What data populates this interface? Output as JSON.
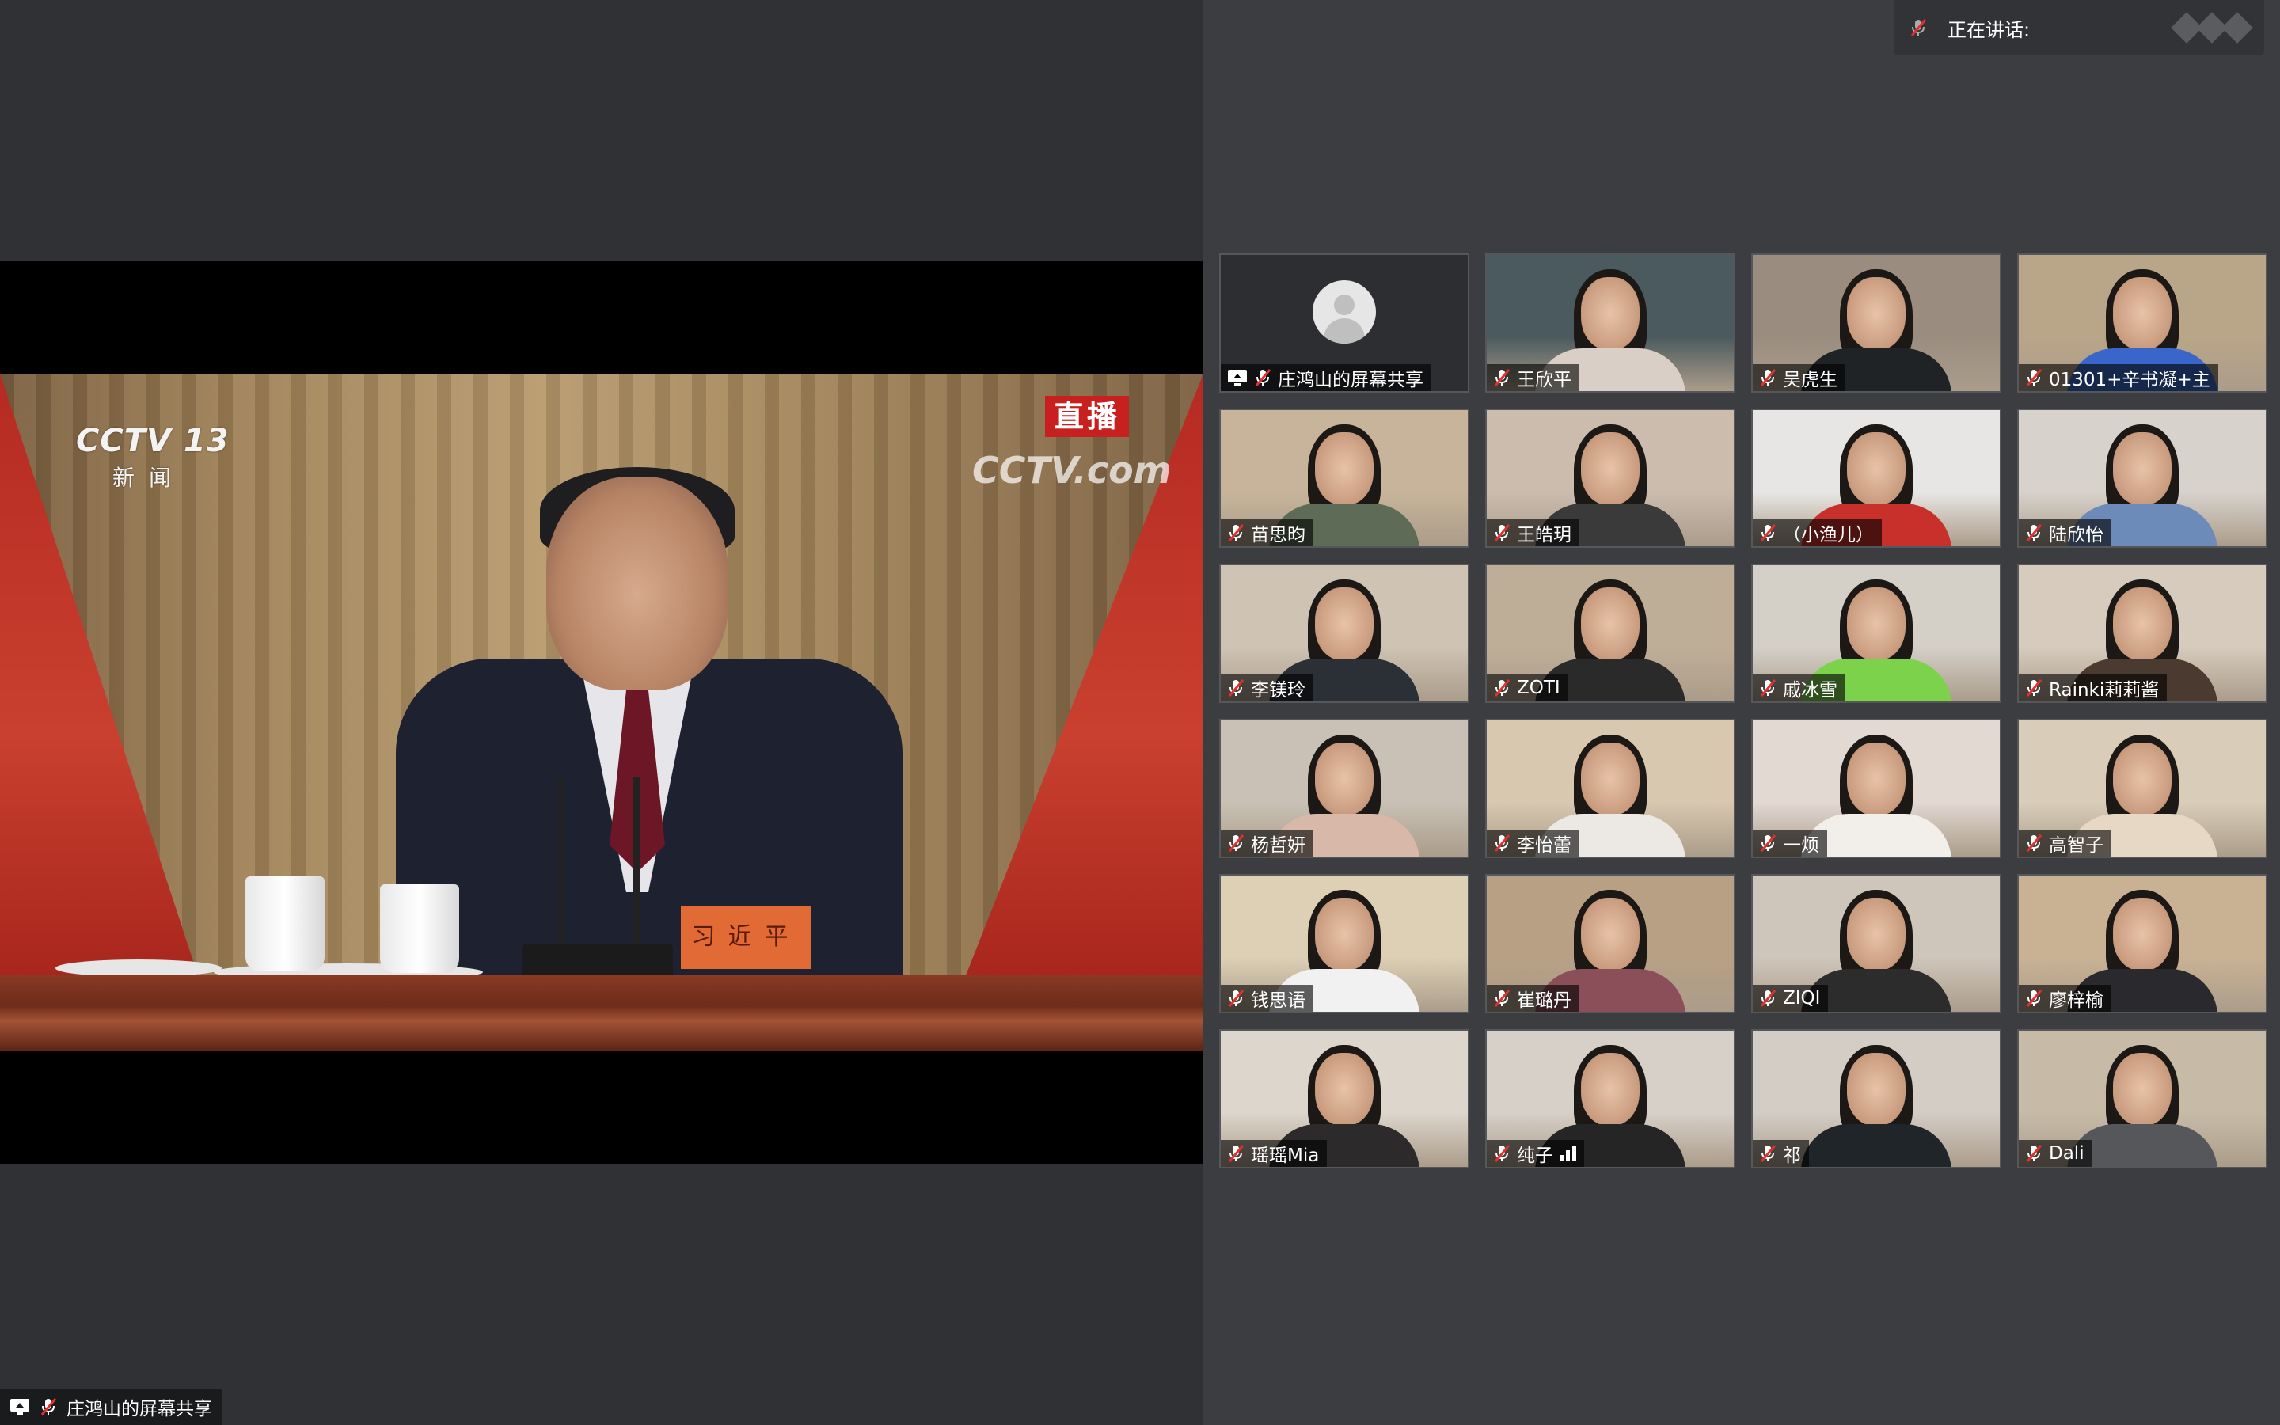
{
  "shared_screen": {
    "cctv_brand": "CCTV 13",
    "cctv_channel": "新闻",
    "live_badge": "直播",
    "watermark": "CCTV.com",
    "nameplate": "习近平"
  },
  "share_label": "庄鸿山的屏幕共享",
  "talking_bar": {
    "label": "正在讲话:"
  },
  "participants": [
    {
      "name": "庄鸿山的屏幕共享",
      "type": "avatar",
      "screen_share": true,
      "bg": "#2d2e32"
    },
    {
      "name": "王欣平",
      "bg": "#4a5a5e",
      "torso": "#d9cfc6"
    },
    {
      "name": "吴虎生",
      "bg": "#9a8d80",
      "torso": "#1f2325"
    },
    {
      "name": "01301+辛书凝+主",
      "bg": "#b9a588",
      "torso": "#3a66c9"
    },
    {
      "name": "苗思昀",
      "bg": "#c7b49a",
      "torso": "#5e6b56"
    },
    {
      "name": "王皓玥",
      "bg": "#cbbcae",
      "torso": "#3a3a3a"
    },
    {
      "name": "（小渔儿）",
      "bg": "#e8e6e4",
      "torso": "#c8302c"
    },
    {
      "name": "陆欣怡",
      "bg": "#d8d2cc",
      "torso": "#6d8bb8"
    },
    {
      "name": "李镁玲",
      "bg": "#cfc3b4",
      "torso": "#2b2f36"
    },
    {
      "name": "ZOTI",
      "bg": "#bfae97",
      "torso": "#2a2a2a"
    },
    {
      "name": "戚冰雪",
      "bg": "#d4d0c8",
      "torso": "#7cd24a"
    },
    {
      "name": "Rainki莉莉酱",
      "bg": "#d6cbbd",
      "torso": "#4a3a30"
    },
    {
      "name": "杨哲妍",
      "bg": "#c9c1b5",
      "torso": "#d8b8a8"
    },
    {
      "name": "李怡蕾",
      "bg": "#d8c8b0",
      "torso": "#ece9e4"
    },
    {
      "name": "一烦",
      "bg": "#e3d9d3",
      "torso": "#f2eeea"
    },
    {
      "name": "高智子",
      "bg": "#d9cdb9",
      "torso": "#e6d8c4"
    },
    {
      "name": "钱思语",
      "bg": "#ddd0b5",
      "torso": "#f1f1f1"
    },
    {
      "name": "崔璐丹",
      "bg": "#b8a085",
      "torso": "#8b4f5a"
    },
    {
      "name": "ZIQI",
      "bg": "#cfc6bb",
      "torso": "#2c2c2c"
    },
    {
      "name": "廖梓榆",
      "bg": "#c9b294",
      "torso": "#2a2a2e"
    },
    {
      "name": "瑶瑶Mia",
      "bg": "#ddd6cc",
      "torso": "#2c2a2a"
    },
    {
      "name": "纯子",
      "bg": "#d7d0c8",
      "torso": "#252525",
      "signal": true
    },
    {
      "name": "祁",
      "bg": "#d4cdc6",
      "torso": "#1f2528"
    },
    {
      "name": "Dali",
      "bg": "#c7bba8",
      "torso": "#55575a"
    }
  ]
}
